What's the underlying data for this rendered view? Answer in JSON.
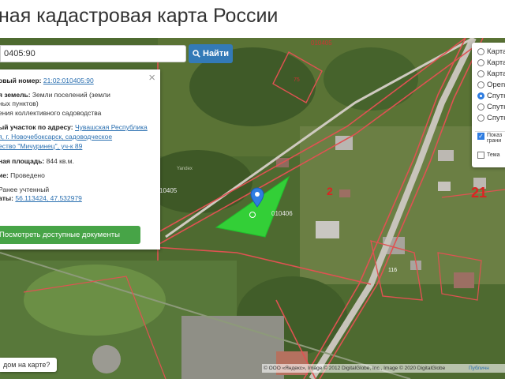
{
  "header": {
    "title": "ная кадастровая карта России"
  },
  "search": {
    "value": "0405:90",
    "button_label": "Найти"
  },
  "info": {
    "cad_label": "овый номер:",
    "cad_value": "21:02:010405:90",
    "land_label": "я земель:",
    "land_value_1": "Земли поселений (земли",
    "land_value_2": "ных пунктов)",
    "usage_value": "ения коллективного садоводства",
    "address_label": "ый участок по адресу:",
    "address_1": "Чувашская Республика",
    "address_2": "я, г. Новочебоксарск, садоводческое",
    "address_3": "ество \"Мичуринец\", уч-к 89",
    "area_label": "ная площадь:",
    "area_value": "844 кв.м.",
    "status_label": "ие:",
    "status_value": "Проведено",
    "registered": "Ранее учтенный",
    "coords_label": "аты:",
    "coords_value": "56.113424, 47.532979",
    "docs_button": "Посмотреть доступные документы"
  },
  "layers": {
    "options": [
      "Карта",
      "Карта",
      "Карта",
      "Open",
      "Спутник",
      "Спутник",
      "Спутник"
    ],
    "selected_index": 4,
    "checks": [
      {
        "label_1": "Показ",
        "label_2": "грани",
        "checked": true
      },
      {
        "label_1": "Тема",
        "label_2": "",
        "checked": false
      }
    ]
  },
  "map_labels": {
    "block_1": "010405",
    "block_2": "10405",
    "block_3": "010406",
    "parcel_75": "75",
    "parcel_116": "116",
    "num_2": "2",
    "num_21": "21",
    "yandex": "Yandex"
  },
  "help_text": "дом на карте?",
  "attribution": "© ООО «Яндекс», Image © 2012 DigitalGlobe, Inc., Image © 2020 DigitalGlobe",
  "public_link": "Публичн"
}
